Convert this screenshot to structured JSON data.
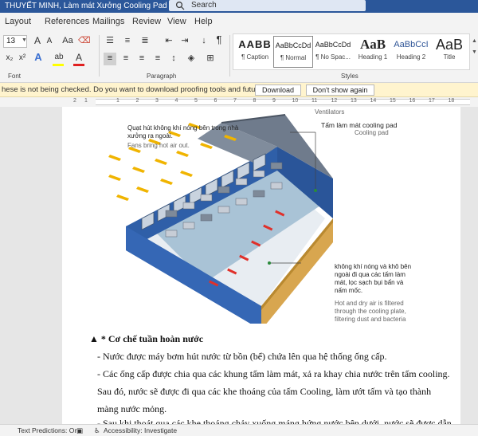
{
  "title_bar": {
    "doc_title": "THUYẾT MINH, Làm mát Xưởng Cooling Pad",
    "search_placeholder": "Search"
  },
  "ribbon_tabs": [
    "Layout",
    "References",
    "Mailings",
    "Review",
    "View",
    "Help"
  ],
  "font_group": {
    "font_size": "13",
    "label": "Font",
    "grow_label": "A",
    "shrink_label": "A",
    "case_label": "Aa",
    "subscript_label": "x₂",
    "superscript_label": "x²",
    "effects_label": "A",
    "highlight_label": "ab",
    "font_color_label": "A",
    "highlight_color": "#ffff00",
    "font_color": "#e02020"
  },
  "paragraph_group": {
    "label": "Paragraph",
    "pilcrow": "¶",
    "sort_icon": "sort-icon"
  },
  "styles_group": {
    "label": "Styles",
    "items": [
      {
        "sample": "AABB",
        "name": "¶ Caption"
      },
      {
        "sample": "AaBbCcDd",
        "name": "¶ Normal"
      },
      {
        "sample": "AaBbCcDd",
        "name": "¶ No Spac..."
      },
      {
        "sample": "AaB",
        "name": "Heading 1"
      },
      {
        "sample": "AaBbCcI",
        "name": "Heading 2"
      },
      {
        "sample": "AaB",
        "name": "Title"
      }
    ],
    "selected_index": 1
  },
  "message_bar": {
    "text": "hese is not being checked. Do you want to download proofing tools and future updates?",
    "download_label": "Download",
    "dismiss_label": "Don't show again"
  },
  "ruler": {
    "left_numbers": [
      "1",
      "2"
    ],
    "right_numbers": [
      "1",
      "2",
      "3",
      "4",
      "5",
      "6",
      "7",
      "8",
      "9",
      "10",
      "11",
      "12",
      "13",
      "14",
      "15",
      "16",
      "17",
      "18"
    ]
  },
  "figure": {
    "top_label_en": "Ventilators",
    "fan_label_vi": "Quạt hút không khí nóng bên trong nhà xưởng ra ngoài.",
    "fan_label_en": "Fans bring hot air out.",
    "pad_label_vi": "Tấm làm mát cooling pad",
    "pad_label_en": "Cooling pad",
    "air_label_vi": "không khí nóng và khô bên ngoài đi qua các tấm làm mát, lọc sạch bụi bẩn và nấm mốc.",
    "air_label_en": "Hot and dry air is filtered through the cooling plate, filtering dust and bacteria",
    "colors": {
      "building_blue": "#2f5fa8",
      "roof": "#6f7b8c",
      "floor": "#a9c3d6",
      "pad": "#d8a64f",
      "fan_arrow": "#f0b400",
      "air_arrow": "#e0302a"
    }
  },
  "document": {
    "heading": "Cơ chế tuần hoàn nước",
    "heading_marker": "▲ *",
    "lines": [
      "- Nước được máy bơm hút nước từ bồn (bể) chứa lên qua hệ thống ống cấp.",
      "- Các ống cấp được chia qua các khung tấm làm mát, xả ra khay chia nước trên tấm cooling.",
      "Sau đó, nước sẽ được đi qua các khe thoáng của tấm Cooling, làm ướt tấm và tạo thành",
      "màng nước mỏng.",
      "- Sau khi thoát qua các khe thoáng chảy xuống máng hứng nước bên dưới, nước sẽ được dẫn"
    ]
  },
  "status_bar": {
    "text_predictions": "Text Predictions: On",
    "accessibility": "Accessibility: Investigate"
  }
}
